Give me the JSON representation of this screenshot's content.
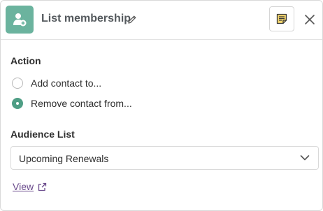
{
  "header": {
    "title": "List membership"
  },
  "action": {
    "label": "Action",
    "options": [
      {
        "label": "Add contact to...",
        "selected": false
      },
      {
        "label": "Remove contact from...",
        "selected": true
      }
    ]
  },
  "audience": {
    "label": "Audience List",
    "selected": "Upcoming Renewals"
  },
  "view_link": {
    "label": "View"
  },
  "colors": {
    "accent": "#6bb39e",
    "radio_selected": "#4f9e85",
    "link": "#6a4a8c"
  }
}
